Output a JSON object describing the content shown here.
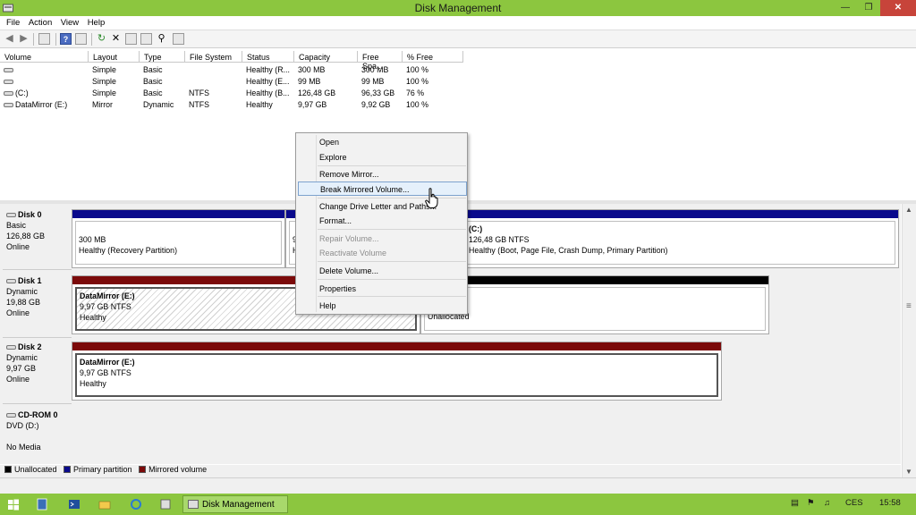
{
  "window": {
    "title": "Disk Management"
  },
  "menu": [
    "File",
    "Action",
    "View",
    "Help"
  ],
  "volume_list": {
    "columns": [
      "Volume",
      "Layout",
      "Type",
      "File System",
      "Status",
      "Capacity",
      "Free Spa...",
      "% Free"
    ],
    "rows": [
      {
        "volume": "",
        "layout": "Simple",
        "type": "Basic",
        "fs": "",
        "status": "Healthy (R...",
        "capacity": "300 MB",
        "free": "300 MB",
        "pct": "100 %"
      },
      {
        "volume": "",
        "layout": "Simple",
        "type": "Basic",
        "fs": "",
        "status": "Healthy (E...",
        "capacity": "99 MB",
        "free": "99 MB",
        "pct": "100 %"
      },
      {
        "volume": "(C:)",
        "layout": "Simple",
        "type": "Basic",
        "fs": "NTFS",
        "status": "Healthy (B...",
        "capacity": "126,48 GB",
        "free": "96,33 GB",
        "pct": "76 %"
      },
      {
        "volume": "DataMirror (E:)",
        "layout": "Mirror",
        "type": "Dynamic",
        "fs": "NTFS",
        "status": "Healthy",
        "capacity": "9,97 GB",
        "free": "9,92 GB",
        "pct": "100 %"
      }
    ]
  },
  "disks": [
    {
      "name": "Disk 0",
      "type": "Basic",
      "size": "126,88 GB",
      "status": "Online",
      "parts": [
        {
          "title": "",
          "line1": "300 MB",
          "line2": "Healthy (Recovery Partition)"
        },
        {
          "title": "",
          "line1": "9",
          "line2": "H"
        },
        {
          "title": "(C:)",
          "line1": "126,48 GB NTFS",
          "line2": "Healthy (Boot, Page File, Crash Dump, Primary Partition)"
        }
      ]
    },
    {
      "name": "Disk 1",
      "type": "Dynamic",
      "size": "19,88 GB",
      "status": "Online",
      "parts": [
        {
          "title": "DataMirror  (E:)",
          "line1": "9,97 GB NTFS",
          "line2": "Healthy"
        },
        {
          "title": "",
          "line1": "",
          "line2": "Unallocated"
        }
      ]
    },
    {
      "name": "Disk 2",
      "type": "Dynamic",
      "size": "9,97 GB",
      "status": "Online",
      "parts": [
        {
          "title": "DataMirror  (E:)",
          "line1": "9,97 GB NTFS",
          "line2": "Healthy"
        }
      ]
    },
    {
      "name": "CD-ROM 0",
      "type": "DVD (D:)",
      "size": "",
      "status": "No Media",
      "parts": []
    }
  ],
  "legend": [
    {
      "label": "Unallocated",
      "color": "#000000"
    },
    {
      "label": "Primary partition",
      "color": "#0a0a8c"
    },
    {
      "label": "Mirrored volume",
      "color": "#7b0a0a"
    }
  ],
  "context_menu": {
    "items": [
      {
        "label": "Open",
        "state": "normal"
      },
      {
        "label": "Explore",
        "state": "normal"
      },
      {
        "label": "Remove Mirror...",
        "state": "normal"
      },
      {
        "label": "Break Mirrored Volume...",
        "state": "highlighted"
      },
      {
        "label": "Change Drive Letter and Paths...",
        "state": "normal"
      },
      {
        "label": "Format...",
        "state": "normal"
      },
      {
        "label": "Repair Volume...",
        "state": "disabled"
      },
      {
        "label": "Reactivate Volume",
        "state": "disabled"
      },
      {
        "label": "Delete Volume...",
        "state": "normal"
      },
      {
        "label": "Properties",
        "state": "normal"
      },
      {
        "label": "Help",
        "state": "normal"
      }
    ]
  },
  "taskbar": {
    "active_task": "Disk Management",
    "language": "CES",
    "time": "15:58"
  },
  "colors": {
    "accent": "#8cc63f",
    "primary": "#0a0a8c",
    "mirror": "#7b0a0a",
    "unallocated": "#000000"
  }
}
